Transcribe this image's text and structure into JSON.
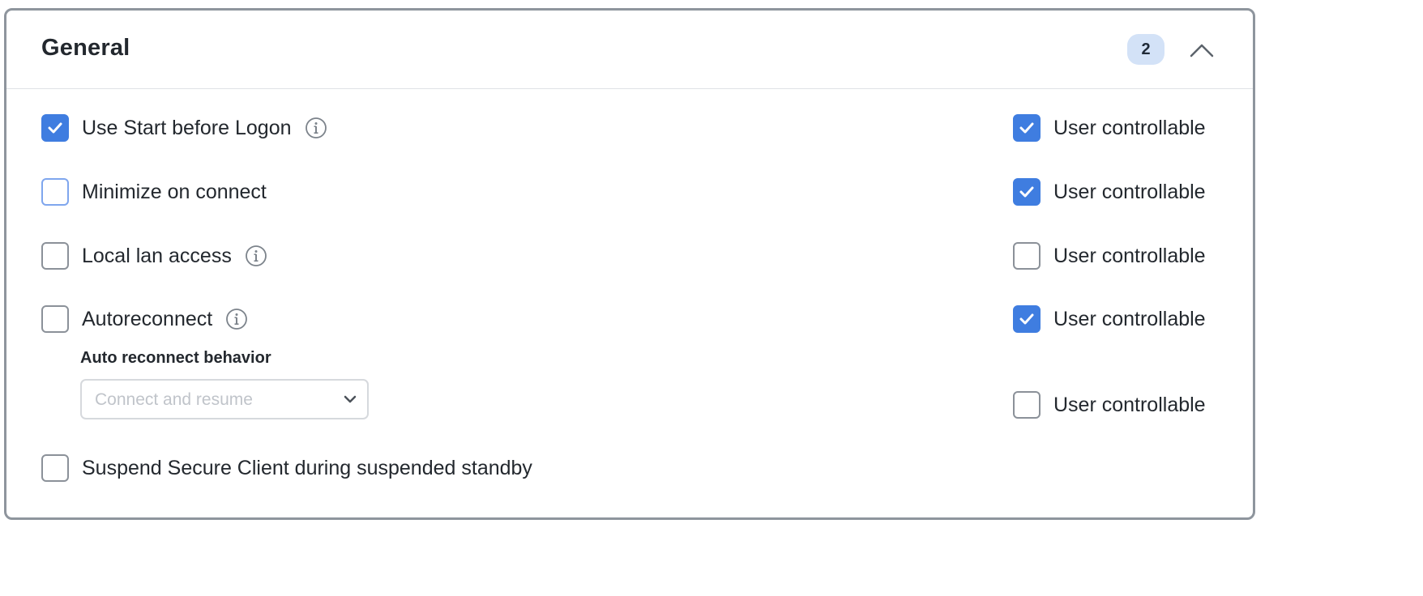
{
  "section": {
    "title": "General",
    "badge_count": "2",
    "collapse_icon": "chevron-up-icon"
  },
  "options": [
    {
      "label": "Use Start before Logon",
      "checked": true,
      "has_info": true,
      "user_controllable": true
    },
    {
      "label": "Minimize on connect",
      "checked": false,
      "has_info": false,
      "user_controllable": true
    },
    {
      "label": "Local lan access",
      "checked": false,
      "has_info": true,
      "user_controllable": false
    },
    {
      "label": "Autoreconnect",
      "checked": false,
      "has_info": true,
      "user_controllable": true
    },
    {
      "label": "Suspend Secure Client during suspended standby",
      "checked": false,
      "has_info": false
    }
  ],
  "autoreconnect_behavior": {
    "label": "Auto reconnect behavior",
    "selected_value": "Connect and resume",
    "user_controllable": false
  },
  "user_controllable_label": "User controllable",
  "colors": {
    "accent": "#3f7de0",
    "badge_bg": "#d3e2f7",
    "border": "#8e959d"
  }
}
